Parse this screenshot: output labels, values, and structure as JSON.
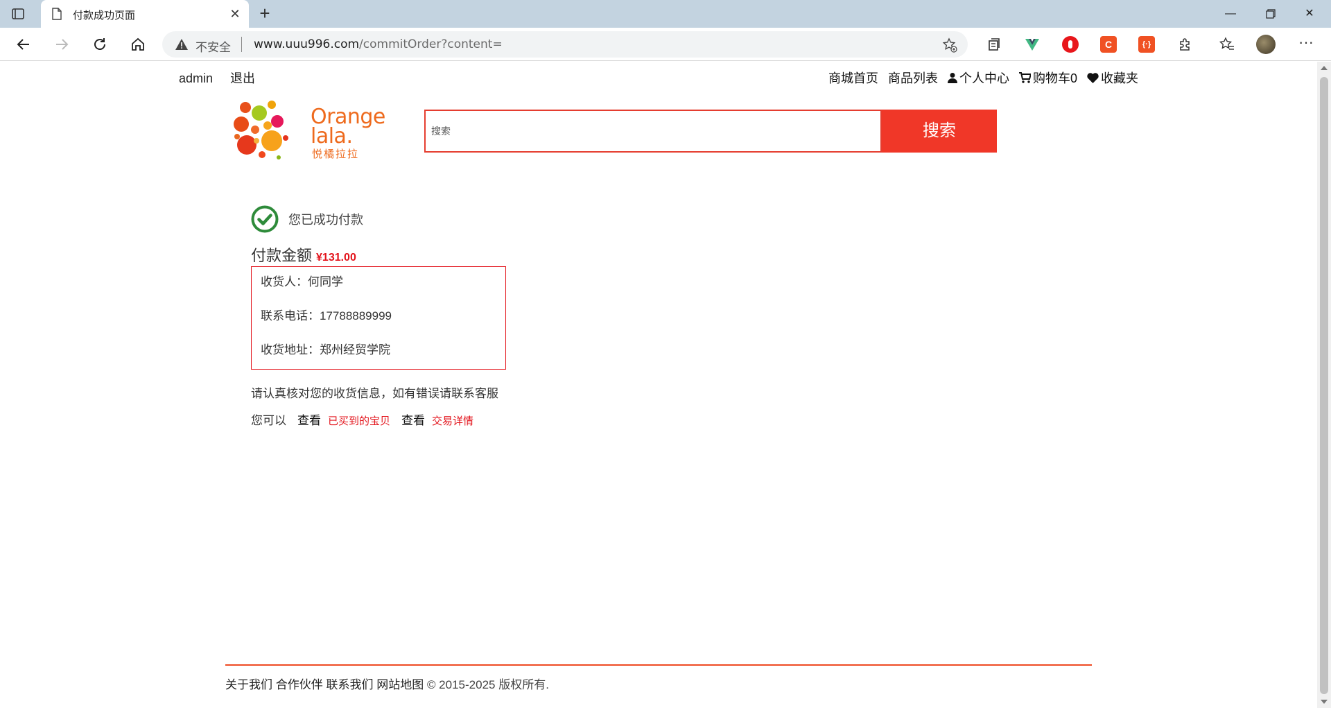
{
  "browser": {
    "tab_title": "付款成功页面",
    "address_insecure": "不安全",
    "url_host": "www.uuu996.com",
    "url_path": "/commitOrder?content="
  },
  "topnav": {
    "user": "admin",
    "logout": "退出",
    "home": "商城首页",
    "product_list": "商品列表",
    "personal_center": "个人中心",
    "cart": "购物车0",
    "favorites": "收藏夹"
  },
  "logo": {
    "brand_line1": "Orange",
    "brand_line2": "lala.",
    "brand_cn": "悦橘拉拉"
  },
  "search": {
    "placeholder": "搜索",
    "button": "搜索"
  },
  "payment": {
    "success_message": "您已成功付款",
    "amount_label": "付款金额",
    "amount_value": "¥131.00",
    "receiver": "收货人：何同学",
    "phone": "联系电话：17788889999",
    "address": "收货地址：郑州经贸学院",
    "verify_notice": "请认真核对您的收货信息，如有错误请联系客服",
    "you_can": "您可以",
    "view1": "查看",
    "purchased_link": "已买到的宝贝",
    "view2": "查看",
    "trade_details_link": "交易详情"
  },
  "footer": {
    "about": "关于我们",
    "partners": "合作伙伴",
    "contact": "联系我们",
    "sitemap": "网站地图",
    "copyright": "© 2015-2025 版权所有."
  },
  "colors": {
    "accent_red": "#f03728",
    "price_red": "#e3131b",
    "success_green": "#2e8b3a",
    "logo_orange": "#ee6a1d"
  }
}
